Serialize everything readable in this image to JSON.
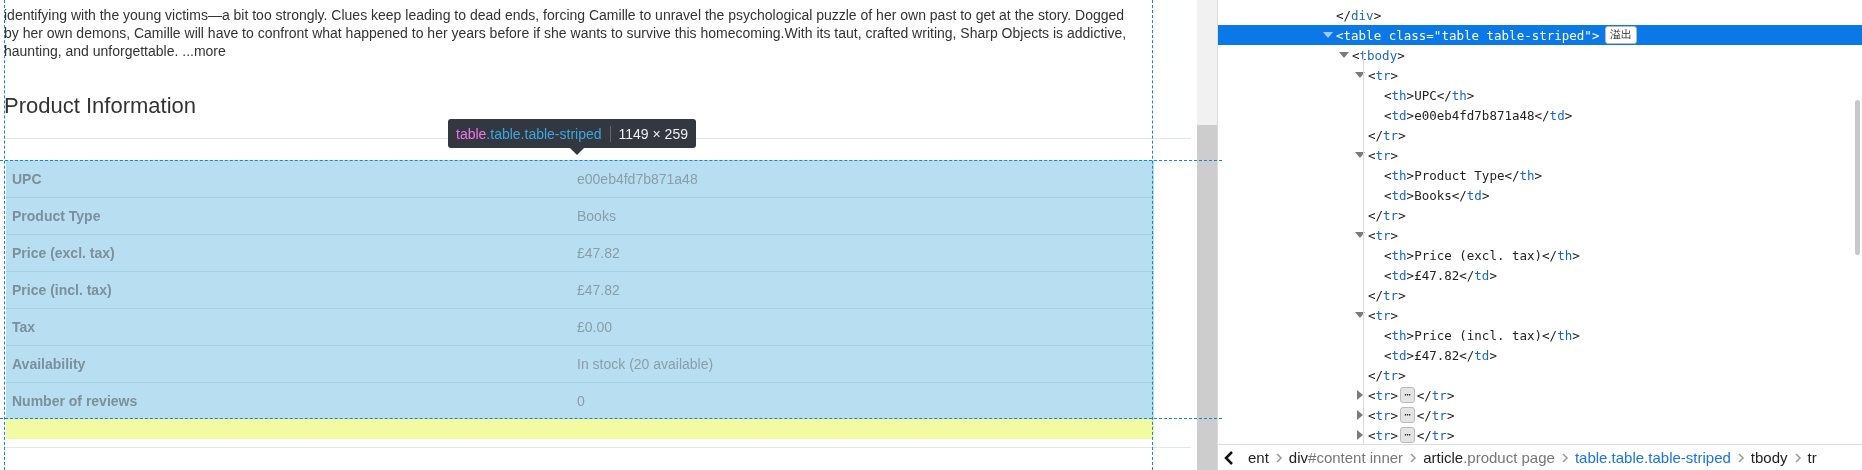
{
  "page": {
    "description": "identifying with the young victims—a bit too strongly. Clues keep leading to dead ends, forcing Camille to unravel the psychological puzzle of her own past to get at the story. Dogged by her own demons, Camille will have to confront what happened to her years before if she wants to survive this homecoming.With its taut, crafted writing, Sharp Objects is addictive, haunting, and unforgettable. ...more",
    "heading": "Product Information",
    "tooltip": {
      "tag": "table",
      "classes": ".table.table-striped",
      "size": "1149 × 259"
    },
    "table": {
      "rows": [
        {
          "header": "UPC",
          "value": "e00eb4fd7b871a48"
        },
        {
          "header": "Product Type",
          "value": "Books"
        },
        {
          "header": "Price (excl. tax)",
          "value": "£47.82"
        },
        {
          "header": "Price (incl. tax)",
          "value": "£47.82"
        },
        {
          "header": "Tax",
          "value": "£0.00"
        },
        {
          "header": "Availability",
          "value": "In stock (20 available)"
        },
        {
          "header": "Number of reviews",
          "value": "0"
        }
      ]
    }
  },
  "devtools": {
    "elements": [
      {
        "open": "</div>",
        "selected": false
      },
      {
        "open": "<table class=\"table table-striped\">",
        "badge": "溢出",
        "selected": true,
        "expanded": true,
        "children": [
          {
            "open": "<tbody>",
            "selected": false,
            "expanded": true,
            "children": [
              {
                "open": "<tr>",
                "selected": false,
                "expanded": true,
                "close": "</tr>",
                "children": [
                  {
                    "open": "<th>UPC</th>",
                    "selected": false
                  },
                  {
                    "open": "<td>e00eb4fd7b871a48</td>",
                    "selected": false
                  }
                ]
              },
              {
                "open": "<tr>",
                "selected": false,
                "expanded": true,
                "close": "</tr>",
                "children": [
                  {
                    "open": "<th>Product Type</th>",
                    "selected": false
                  },
                  {
                    "open": "<td>Books</td>",
                    "selected": false
                  }
                ]
              },
              {
                "open": "<tr>",
                "selected": false,
                "expanded": true,
                "close": "</tr>",
                "children": [
                  {
                    "open": "<th>Price (excl. tax)</th>",
                    "selected": false
                  },
                  {
                    "open": "<td>£47.82</td>",
                    "selected": false
                  }
                ]
              },
              {
                "open": "<tr>",
                "selected": false,
                "expanded": true,
                "close": "</tr>",
                "children": [
                  {
                    "open": "<th>Price (incl. tax)</th>",
                    "selected": false
                  },
                  {
                    "open": "<td>£47.82</td>",
                    "selected": false
                  }
                ]
              },
              {
                "open": "<tr>",
                "selected": false,
                "expanded": false,
                "ellipsis": "⋯",
                "close": "</tr>"
              },
              {
                "open": "<tr>",
                "selected": false,
                "expanded": false,
                "ellipsis": "⋯",
                "close": "</tr>"
              },
              {
                "open": "<tr>",
                "selected": false,
                "expanded": false,
                "ellipsis": "⋯",
                "close": "</tr>"
              }
            ]
          }
        ]
      }
    ],
    "breadcrumbs": [
      {
        "label": "ent",
        "selected": false
      },
      {
        "label": "div#content inner",
        "selected": false
      },
      {
        "label": "article.product page",
        "selected": false
      },
      {
        "label": "table.table.table-striped",
        "selected": true
      },
      {
        "label": "tbody",
        "selected": false
      },
      {
        "label": "tr",
        "selected": false
      }
    ]
  }
}
